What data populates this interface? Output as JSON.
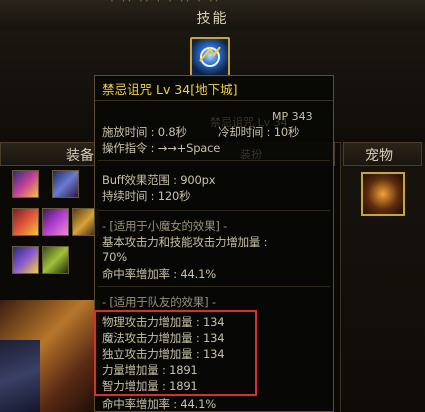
{
  "header": {
    "partial_text": "· ·· ·· · · ·· ·  ··",
    "section_title": "技能"
  },
  "panels": {
    "equipment_label": "装备",
    "pet_label": "宠物"
  },
  "tooltip": {
    "title": "禁忌诅咒 Lv 34[地下城]",
    "ghost_text_1": "禁忌诅咒 Lv 34",
    "ghost_text_2": "装扮",
    "mp": "MP 343",
    "cast_time": "施放时间 : 0.8秒",
    "cooldown": "冷却时间 : 10秒",
    "command": "操作指令 : →→+Space",
    "buff_range": "Buff效果范围 : 900px",
    "duration": "持续时间 : 120秒",
    "self_header": "- [适用于小魔女的效果] -",
    "self_effect_1": "基本攻击力和技能攻击力增加量 :",
    "self_effect_1_value": "70%",
    "self_hit": "命中率增加率 : 44.1%",
    "team_header": "- [适用于队友的效果] -",
    "team_effects": [
      "物理攻击力增加量 : 134",
      "魔法攻击力增加量 : 134",
      "独立攻击力增加量 : 134",
      "力量增加量 : 1891",
      "智力增加量 : 1891"
    ],
    "team_hit_partial": "命中率增加率 : 44.1%"
  },
  "colors": {
    "title_yellow": "#f4d23b",
    "highlight_red": "#d8302c",
    "gold_border": "#c9a43a"
  }
}
